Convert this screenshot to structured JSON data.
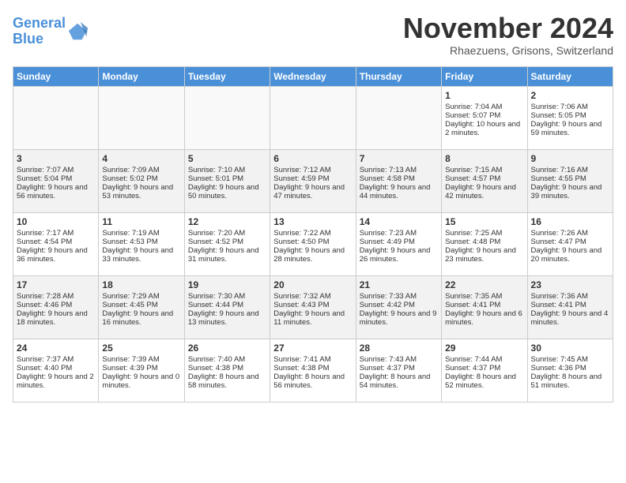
{
  "logo": {
    "line1": "General",
    "line2": "Blue"
  },
  "title": "November 2024",
  "subtitle": "Rhaezuens, Grisons, Switzerland",
  "headers": [
    "Sunday",
    "Monday",
    "Tuesday",
    "Wednesday",
    "Thursday",
    "Friday",
    "Saturday"
  ],
  "weeks": [
    [
      {
        "day": "",
        "info": ""
      },
      {
        "day": "",
        "info": ""
      },
      {
        "day": "",
        "info": ""
      },
      {
        "day": "",
        "info": ""
      },
      {
        "day": "",
        "info": ""
      },
      {
        "day": "1",
        "info": "Sunrise: 7:04 AM\nSunset: 5:07 PM\nDaylight: 10 hours and 2 minutes."
      },
      {
        "day": "2",
        "info": "Sunrise: 7:06 AM\nSunset: 5:05 PM\nDaylight: 9 hours and 59 minutes."
      }
    ],
    [
      {
        "day": "3",
        "info": "Sunrise: 7:07 AM\nSunset: 5:04 PM\nDaylight: 9 hours and 56 minutes."
      },
      {
        "day": "4",
        "info": "Sunrise: 7:09 AM\nSunset: 5:02 PM\nDaylight: 9 hours and 53 minutes."
      },
      {
        "day": "5",
        "info": "Sunrise: 7:10 AM\nSunset: 5:01 PM\nDaylight: 9 hours and 50 minutes."
      },
      {
        "day": "6",
        "info": "Sunrise: 7:12 AM\nSunset: 4:59 PM\nDaylight: 9 hours and 47 minutes."
      },
      {
        "day": "7",
        "info": "Sunrise: 7:13 AM\nSunset: 4:58 PM\nDaylight: 9 hours and 44 minutes."
      },
      {
        "day": "8",
        "info": "Sunrise: 7:15 AM\nSunset: 4:57 PM\nDaylight: 9 hours and 42 minutes."
      },
      {
        "day": "9",
        "info": "Sunrise: 7:16 AM\nSunset: 4:55 PM\nDaylight: 9 hours and 39 minutes."
      }
    ],
    [
      {
        "day": "10",
        "info": "Sunrise: 7:17 AM\nSunset: 4:54 PM\nDaylight: 9 hours and 36 minutes."
      },
      {
        "day": "11",
        "info": "Sunrise: 7:19 AM\nSunset: 4:53 PM\nDaylight: 9 hours and 33 minutes."
      },
      {
        "day": "12",
        "info": "Sunrise: 7:20 AM\nSunset: 4:52 PM\nDaylight: 9 hours and 31 minutes."
      },
      {
        "day": "13",
        "info": "Sunrise: 7:22 AM\nSunset: 4:50 PM\nDaylight: 9 hours and 28 minutes."
      },
      {
        "day": "14",
        "info": "Sunrise: 7:23 AM\nSunset: 4:49 PM\nDaylight: 9 hours and 26 minutes."
      },
      {
        "day": "15",
        "info": "Sunrise: 7:25 AM\nSunset: 4:48 PM\nDaylight: 9 hours and 23 minutes."
      },
      {
        "day": "16",
        "info": "Sunrise: 7:26 AM\nSunset: 4:47 PM\nDaylight: 9 hours and 20 minutes."
      }
    ],
    [
      {
        "day": "17",
        "info": "Sunrise: 7:28 AM\nSunset: 4:46 PM\nDaylight: 9 hours and 18 minutes."
      },
      {
        "day": "18",
        "info": "Sunrise: 7:29 AM\nSunset: 4:45 PM\nDaylight: 9 hours and 16 minutes."
      },
      {
        "day": "19",
        "info": "Sunrise: 7:30 AM\nSunset: 4:44 PM\nDaylight: 9 hours and 13 minutes."
      },
      {
        "day": "20",
        "info": "Sunrise: 7:32 AM\nSunset: 4:43 PM\nDaylight: 9 hours and 11 minutes."
      },
      {
        "day": "21",
        "info": "Sunrise: 7:33 AM\nSunset: 4:42 PM\nDaylight: 9 hours and 9 minutes."
      },
      {
        "day": "22",
        "info": "Sunrise: 7:35 AM\nSunset: 4:41 PM\nDaylight: 9 hours and 6 minutes."
      },
      {
        "day": "23",
        "info": "Sunrise: 7:36 AM\nSunset: 4:41 PM\nDaylight: 9 hours and 4 minutes."
      }
    ],
    [
      {
        "day": "24",
        "info": "Sunrise: 7:37 AM\nSunset: 4:40 PM\nDaylight: 9 hours and 2 minutes."
      },
      {
        "day": "25",
        "info": "Sunrise: 7:39 AM\nSunset: 4:39 PM\nDaylight: 9 hours and 0 minutes."
      },
      {
        "day": "26",
        "info": "Sunrise: 7:40 AM\nSunset: 4:38 PM\nDaylight: 8 hours and 58 minutes."
      },
      {
        "day": "27",
        "info": "Sunrise: 7:41 AM\nSunset: 4:38 PM\nDaylight: 8 hours and 56 minutes."
      },
      {
        "day": "28",
        "info": "Sunrise: 7:43 AM\nSunset: 4:37 PM\nDaylight: 8 hours and 54 minutes."
      },
      {
        "day": "29",
        "info": "Sunrise: 7:44 AM\nSunset: 4:37 PM\nDaylight: 8 hours and 52 minutes."
      },
      {
        "day": "30",
        "info": "Sunrise: 7:45 AM\nSunset: 4:36 PM\nDaylight: 8 hours and 51 minutes."
      }
    ]
  ]
}
